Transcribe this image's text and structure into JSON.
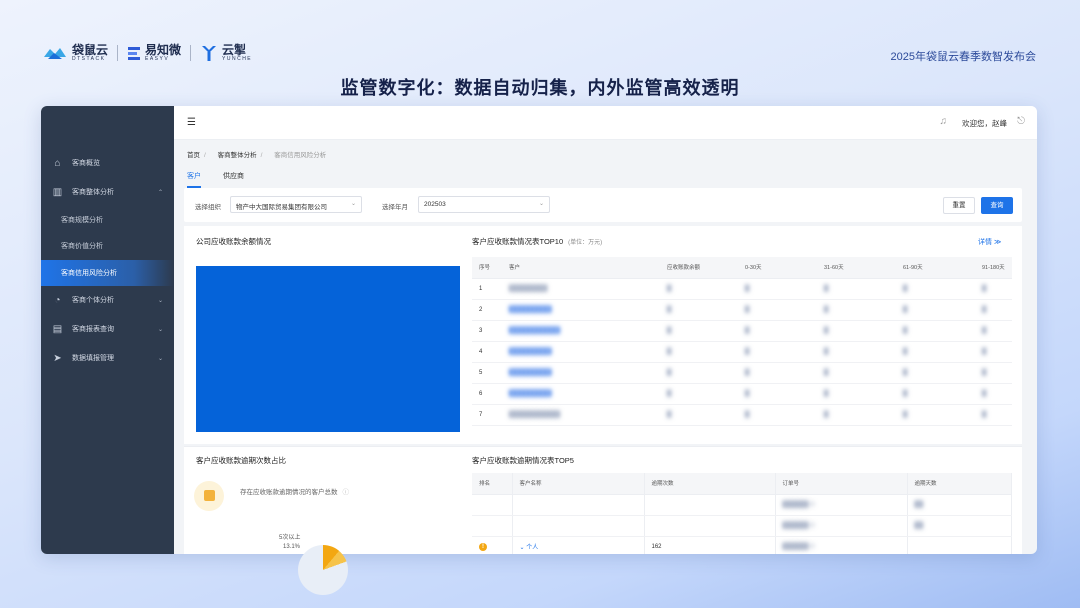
{
  "brand": {
    "logos": [
      {
        "name": "袋鼠云",
        "sub": "DTSTACK"
      },
      {
        "name": "易知微",
        "sub": "EASYV"
      },
      {
        "name": "云掣",
        "sub": "YUNCHE"
      }
    ],
    "event": "2025年袋鼠云春季数智发布会"
  },
  "headline": "监管数字化：数据自动归集，内外监管高效透明",
  "sidebar": {
    "items": [
      {
        "label": "客商概览",
        "icon": "home-icon"
      },
      {
        "label": "客商整体分析",
        "icon": "chart-icon",
        "expanded": true
      },
      {
        "label": "客商规模分析",
        "sub": true
      },
      {
        "label": "客商价值分析",
        "sub": true
      },
      {
        "label": "客商信用风险分析",
        "sub": true,
        "active": true
      },
      {
        "label": "客商个体分析",
        "icon": "pie-icon"
      },
      {
        "label": "客商报表查询",
        "icon": "report-icon"
      },
      {
        "label": "数据填报管理",
        "icon": "send-icon"
      }
    ]
  },
  "topbar": {
    "welcome": "欢迎您，赵峰"
  },
  "breadcrumb": [
    "首页",
    "客商整体分析",
    "客商信用风险分析"
  ],
  "tabs": [
    "客户",
    "供应商"
  ],
  "filter": {
    "org_label": "选择组织",
    "org_value": "物产中大国际贸易集团有限公司",
    "month_label": "选择年月",
    "month_value": "202503",
    "reset": "重置",
    "query": "查询"
  },
  "panel1": {
    "title": "公司应收账款余额情况"
  },
  "panel2": {
    "title": "客户应收账款情况表TOP10",
    "unit": "(单位：万元)",
    "detail": "详情 ≫",
    "columns": [
      "序号",
      "客户",
      "应收账款余额",
      "0-30天",
      "31-60天",
      "61-90天",
      "91-180天"
    ],
    "rows": [
      "1",
      "2",
      "3",
      "4",
      "5",
      "6",
      "7"
    ]
  },
  "panel3": {
    "title": "客户应收账款逾期次数占比",
    "desc": "存在应收账款逾期情况的客户总数",
    "donut_label": "5次以上",
    "donut_value": "13.1%"
  },
  "panel4": {
    "title": "客户应收账款逾期情况表TOP5",
    "columns": [
      "排名",
      "客户名称",
      "逾期次数",
      "订单号",
      "逾期天数"
    ],
    "row3": {
      "name": "个人",
      "count": "162"
    }
  }
}
